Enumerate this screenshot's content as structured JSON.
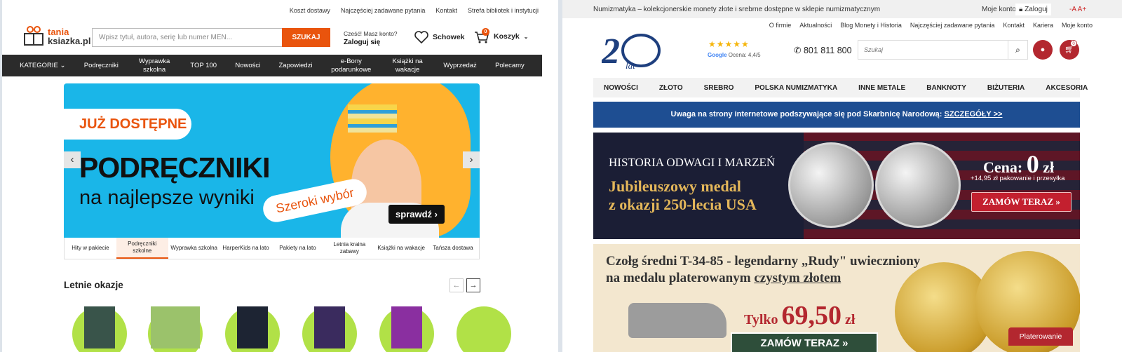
{
  "left": {
    "top_links": [
      "Koszt dostawy",
      "Najczęściej zadawane pytania",
      "Kontakt",
      "Strefa bibliotek i instytucji"
    ],
    "logo": {
      "line1": "tania",
      "line2": "ksiazka.pl"
    },
    "search": {
      "placeholder": "Wpisz tytuł, autora, serię lub numer MEN...",
      "button": "SZUKAJ"
    },
    "account": {
      "greeting": "Cześć! Masz konto?",
      "login": "Zaloguj się"
    },
    "favorites": "Schowek",
    "cart": {
      "label": "Koszyk",
      "count": "0"
    },
    "nav": [
      "KATEGORIE",
      "Podręczniki",
      "Wyprawka szkolna",
      "TOP 100",
      "Nowości",
      "Zapowiedzi",
      "e-Bony podarunkowe",
      "Książki na wakacje",
      "Wyprzedaż",
      "Polecamy"
    ],
    "hero": {
      "tag": "JUŻ DOSTĘPNE",
      "title": "PODRĘCZNIKI",
      "subtitle": "na najlepsze wyniki",
      "pill": "Szeroki wybór",
      "cta": "sprawdź"
    },
    "tabs": [
      "Hity w pakiecie",
      "Podręczniki szkolne",
      "Wyprawka szkolna",
      "HarperKids na lato",
      "Pakiety na lato",
      "Letnia kraina zabawy",
      "Książki na wakacje",
      "Tańsza dostawa"
    ],
    "section_title": "Letnie okazje"
  },
  "right": {
    "top_text": "Numizmatyka – kolekcjonerskie monety złote i srebrne dostępne w sklepie numizmatycznym",
    "my_account": "Moje konto:",
    "login": "Zaloguj",
    "font_size": "-A A+",
    "links": [
      "O firmie",
      "Aktualności",
      "Blog Monety i Historia",
      "Najczęściej zadawane pytania",
      "Kontakt",
      "Kariera",
      "Moje konto"
    ],
    "logo_text": "lat",
    "rating": "Ocena: 4,4/5",
    "rating_brand": "Google",
    "phone": "801 811 800",
    "search_placeholder": "Szukaj",
    "cart_count": "0",
    "nav": [
      "NOWOŚCI",
      "ZŁOTO",
      "SREBRO",
      "POLSKA NUMIZMATYKA",
      "INNE METALE",
      "BANKNOTY",
      "BIŻUTERIA",
      "AKCESORIA"
    ],
    "warning": {
      "text": "Uwaga na strony internetowe podszywające się pod Skarbnicę Narodową: ",
      "link": "SZCZEGÓŁY >>"
    },
    "banner1": {
      "kicker": "HISTORIA ODWAGI I MARZEŃ",
      "title1": "Jubileuszowy medal",
      "title2": "z okazji 250-lecia USA",
      "price_label": "Cena:",
      "price": "0",
      "currency": "zł",
      "shipping": "+14,95 zł pakowanie i przesyłka",
      "button": "ZAMÓW TERAZ"
    },
    "banner2": {
      "line1": "Czołg średni T-34-85 - legendarny „Rudy\" uwieczniony",
      "line2a": "na medalu platerowanym ",
      "line2b": "czystym złotem",
      "price_prefix": "Tylko",
      "price": "69,50",
      "currency": "zł",
      "button": "ZAMÓW TERAZ »",
      "badge": "Platerowanie"
    }
  }
}
